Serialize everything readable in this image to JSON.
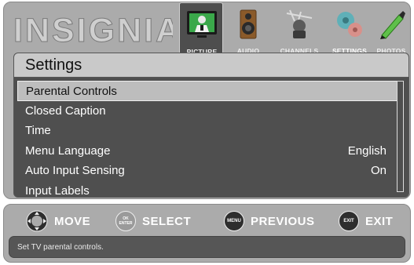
{
  "brand": {
    "logo_text": "INSIGNIA"
  },
  "nav": {
    "tabs": [
      {
        "label": "PICTURE",
        "icon": "picture-icon"
      },
      {
        "label": "AUDIO",
        "icon": "audio-icon"
      },
      {
        "label": "CHANNELS",
        "icon": "channels-icon"
      },
      {
        "label": "SETTINGS",
        "icon": "settings-icon"
      },
      {
        "label": "PHOTOS",
        "icon": "photos-icon"
      }
    ]
  },
  "settings": {
    "title": "Settings",
    "items": [
      {
        "label": "Parental Controls",
        "value": ""
      },
      {
        "label": "Closed Caption",
        "value": ""
      },
      {
        "label": "Time",
        "value": ""
      },
      {
        "label": "Menu Language",
        "value": "English"
      },
      {
        "label": "Auto Input Sensing",
        "value": "On"
      },
      {
        "label": "Input Labels",
        "value": ""
      }
    ]
  },
  "footer": {
    "hints": [
      {
        "label": "MOVE",
        "icon": "dpad-icon",
        "button_text": ""
      },
      {
        "label": "SELECT",
        "icon": "ok-enter-button-icon",
        "button_text": "OK ENTER"
      },
      {
        "label": "PREVIOUS",
        "icon": "menu-button-icon",
        "button_text": "MENU"
      },
      {
        "label": "EXIT",
        "icon": "exit-button-icon",
        "button_text": "EXIT"
      }
    ],
    "description": "Set TV parental controls."
  }
}
